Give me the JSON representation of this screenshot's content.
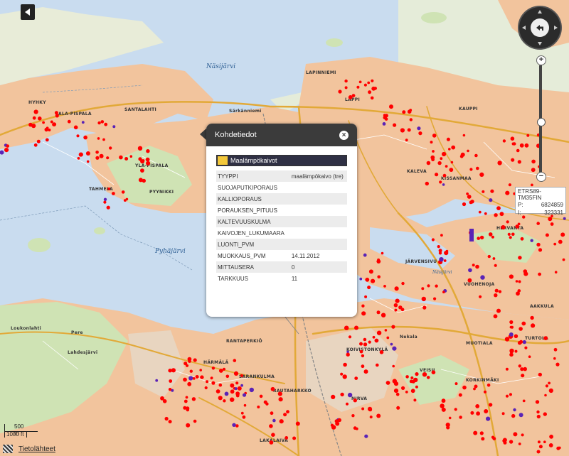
{
  "map": {
    "water_labels": [
      "Näsijärvi",
      "Pyhäjärvi",
      "Näsijärvi"
    ],
    "place_labels": [
      "HYHKY",
      "ALA-PISPALA",
      "SANTALAHTI",
      "YLÄ-PISPALA",
      "TAHMELA",
      "PYYNIKKI",
      "LAPINNIEMI",
      "LAPPI",
      "KAUPPI",
      "KALEVA",
      "KISSANMAA",
      "HERVANTA",
      "JÄRVENSIVU",
      "VUOHENOJA",
      "AAKKULA",
      "RANTAPERKIÖ",
      "HÄRMÄLÄ",
      "SARANKULMA",
      "RAUTAHARKKO",
      "KOIVISTONKYLÄ",
      "VEISU",
      "NIRVA",
      "MUOTIALA",
      "TURTOLA",
      "KORKINMÄKI",
      "LAKALAIVA",
      "Särkänniemi",
      "Nekala",
      "Loukonlahti",
      "Pere",
      "Lahdesjärvi"
    ]
  },
  "controls": {
    "zoom_in": "+",
    "zoom_out": "−"
  },
  "coordinates": {
    "system": "ETRS89-TM35FIN",
    "p_label": "P:",
    "p_value": "6824859",
    "i_label": "I:",
    "i_value": "323331"
  },
  "popup": {
    "title": "Kohdetiedot",
    "close": "×",
    "layer_name": "Maalämpökaivot",
    "rows": [
      {
        "key": "TYYPPI",
        "value": "maalämpökaivo (tre)"
      },
      {
        "key": "SUOJAPUTKIPORAUS",
        "value": ""
      },
      {
        "key": "KALLIOPORAUS",
        "value": ""
      },
      {
        "key": "PORAUKSEN_PITUUS",
        "value": ""
      },
      {
        "key": "KALTEVUUSKULMA",
        "value": ""
      },
      {
        "key": "KAIVOJEN_LUKUMAARA",
        "value": ""
      },
      {
        "key": "LUONTI_PVM",
        "value": ""
      },
      {
        "key": "MUOKKAUS_PVM",
        "value": "14.11.2012"
      },
      {
        "key": "MITTAUSERA",
        "value": "0"
      },
      {
        "key": "TARKKUUS",
        "value": "11"
      }
    ]
  },
  "scale": {
    "top": "500 m",
    "bottom": "1000 ft"
  },
  "attribution": {
    "label": "Tietolähteet"
  },
  "colors": {
    "water": "#c9dcef",
    "urban": "#f2c49d",
    "forest": "#cfe3b4",
    "road_major": "#e2a938",
    "well_point": "#ff0000",
    "well_point_alt": "#5a23b6",
    "popup_header": "#3b3b3b"
  }
}
